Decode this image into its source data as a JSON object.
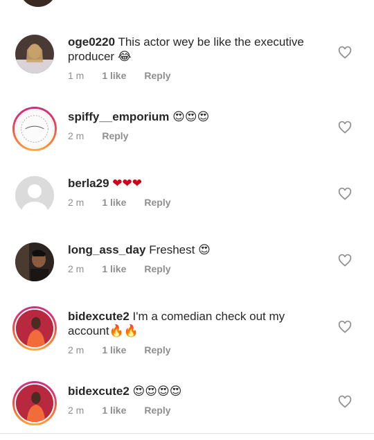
{
  "comments": [
    {
      "username": "oge0220",
      "text": "This actor wey be like the executive producer",
      "emoji": "😂",
      "time": "1 m",
      "likes": "1 like",
      "reply": "Reply"
    },
    {
      "username": "spiffy__emporium",
      "text": "",
      "emoji": "😍😍😍",
      "time": "2 m",
      "likes": "",
      "reply": "Reply"
    },
    {
      "username": "berla29",
      "text": "",
      "emoji": "❤❤❤",
      "time": "2 m",
      "likes": "1 like",
      "reply": "Reply"
    },
    {
      "username": "long_ass_day",
      "text": "Freshest",
      "emoji": "😍",
      "time": "2 m",
      "likes": "1 like",
      "reply": "Reply"
    },
    {
      "username": "bidexcute2",
      "text": "I'm a comedian check out my account",
      "emoji": "🔥🔥",
      "time": "2 m",
      "likes": "1 like",
      "reply": "Reply"
    },
    {
      "username": "bidexcute2",
      "text": "",
      "emoji": "😍😍😍😍",
      "time": "2 m",
      "likes": "1 like",
      "reply": "Reply"
    }
  ]
}
